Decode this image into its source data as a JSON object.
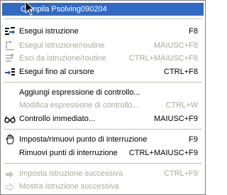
{
  "menu": {
    "items": [
      {
        "label": "Compila Psolving090204",
        "shortcut": "",
        "state": "highlighted"
      },
      {
        "label": "Esegui istruzione",
        "shortcut": "F8",
        "state": "enabled",
        "icon": "step-into-icon"
      },
      {
        "label": "Esegui istruzione/routine",
        "shortcut": "MAIUSC+F8",
        "state": "disabled",
        "icon": "step-over-icon"
      },
      {
        "label": "Esci da istruzione/routine",
        "shortcut": "CTRL+MAIUSC+F8",
        "state": "disabled",
        "icon": "step-out-icon"
      },
      {
        "label": "Esegui fino al cursore",
        "shortcut": "CTRL+F8",
        "state": "enabled",
        "icon": "run-to-cursor-icon"
      },
      {
        "label": "Aggiungi espressione di controllo...",
        "shortcut": "",
        "state": "enabled"
      },
      {
        "label": "Modifica espressione di controllo...",
        "shortcut": "CTRL+W",
        "state": "disabled"
      },
      {
        "label": "Controllo immediato...",
        "shortcut": "MAIUSC+F9",
        "state": "enabled",
        "icon": "glasses-icon"
      },
      {
        "label": "Imposta/rimuovi punto di interruzione",
        "shortcut": "F9",
        "state": "enabled",
        "icon": "hand-icon"
      },
      {
        "label": "Rimuovi punti di interruzione",
        "shortcut": "CTRL+MAIUSC+F9",
        "state": "enabled"
      },
      {
        "label": "Imposta istruzione successiva",
        "shortcut": "CTRL+F9",
        "state": "disabled",
        "icon": "arrow-right-icon"
      },
      {
        "label": "Mostra istruzione successiva",
        "shortcut": "",
        "state": "disabled",
        "icon": "arrow-outline-icon"
      }
    ]
  }
}
